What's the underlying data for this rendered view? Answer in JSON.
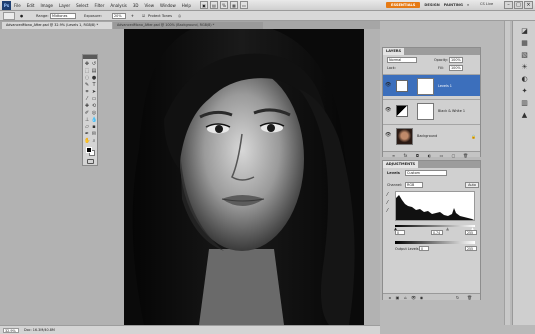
{
  "app": {
    "logo": "Ps",
    "menu": [
      "File",
      "Edit",
      "Image",
      "Layer",
      "Select",
      "Filter",
      "Analysis",
      "3D",
      "View",
      "Window",
      "Help"
    ],
    "workspaces": {
      "active": "ESSENTIALS",
      "others": [
        "DESIGN",
        "PAINTING"
      ],
      "more": "»"
    },
    "cs_live": "CS Live",
    "window_controls": [
      "–",
      "□",
      "×"
    ]
  },
  "options_bar": {
    "range_label": "Range:",
    "range_value": "Midtones",
    "exposure_label": "Exposure:",
    "exposure_value": "20%",
    "protect_tones_label": "Protect Tones"
  },
  "document": {
    "active_tab": "AdvancedMono_After.psd @ 32.9% (Levels 1, RGB/8) *",
    "other_tab": "AdvancedMono_After.psd @ 100% (Background, RGB/8) *",
    "zoom": "32.9%",
    "doc_size": "Doc: 16.3M/40.8M"
  },
  "layers_panel": {
    "title": "LAYERS",
    "blend_mode": "Normal",
    "opacity_label": "Opacity:",
    "opacity_value": "100%",
    "lock_label": "Lock:",
    "fill_label": "Fill:",
    "fill_value": "100%",
    "layers": [
      {
        "name": "Levels 1",
        "selected": true
      },
      {
        "name": "Black & White 1",
        "selected": false
      },
      {
        "name": "Background",
        "selected": false
      }
    ]
  },
  "adjustments_panel": {
    "title": "ADJUSTMENTS",
    "type_label": "Levels",
    "preset": "Custom",
    "channel_label": "Channel:",
    "channel_value": "RGB",
    "auto_label": "Auto",
    "input_black": "0",
    "input_mid": "0.74",
    "input_white": "255",
    "output_label": "Output Levels:",
    "output_black": "0",
    "output_white": "255"
  },
  "colors": {
    "accent_orange": "#e67a14",
    "selected_layer": "#3c6fbc",
    "foreground": "#000000",
    "background": "#ffffff"
  }
}
